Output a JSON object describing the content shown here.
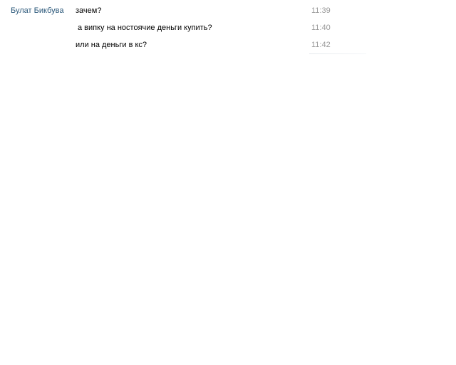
{
  "conversation": {
    "sender": "Булат Бикбува",
    "messages": [
      {
        "text": "зачем?",
        "time": "11:39"
      },
      {
        "text": "а випку на ностоячие деньги купить?",
        "time": "11:40"
      },
      {
        "text": "или на деньги в кс?",
        "time": "11:42"
      }
    ]
  },
  "colors": {
    "sender_link": "#2b587a",
    "timestamp": "#999999",
    "message_text": "#000000",
    "background": "#ffffff"
  }
}
